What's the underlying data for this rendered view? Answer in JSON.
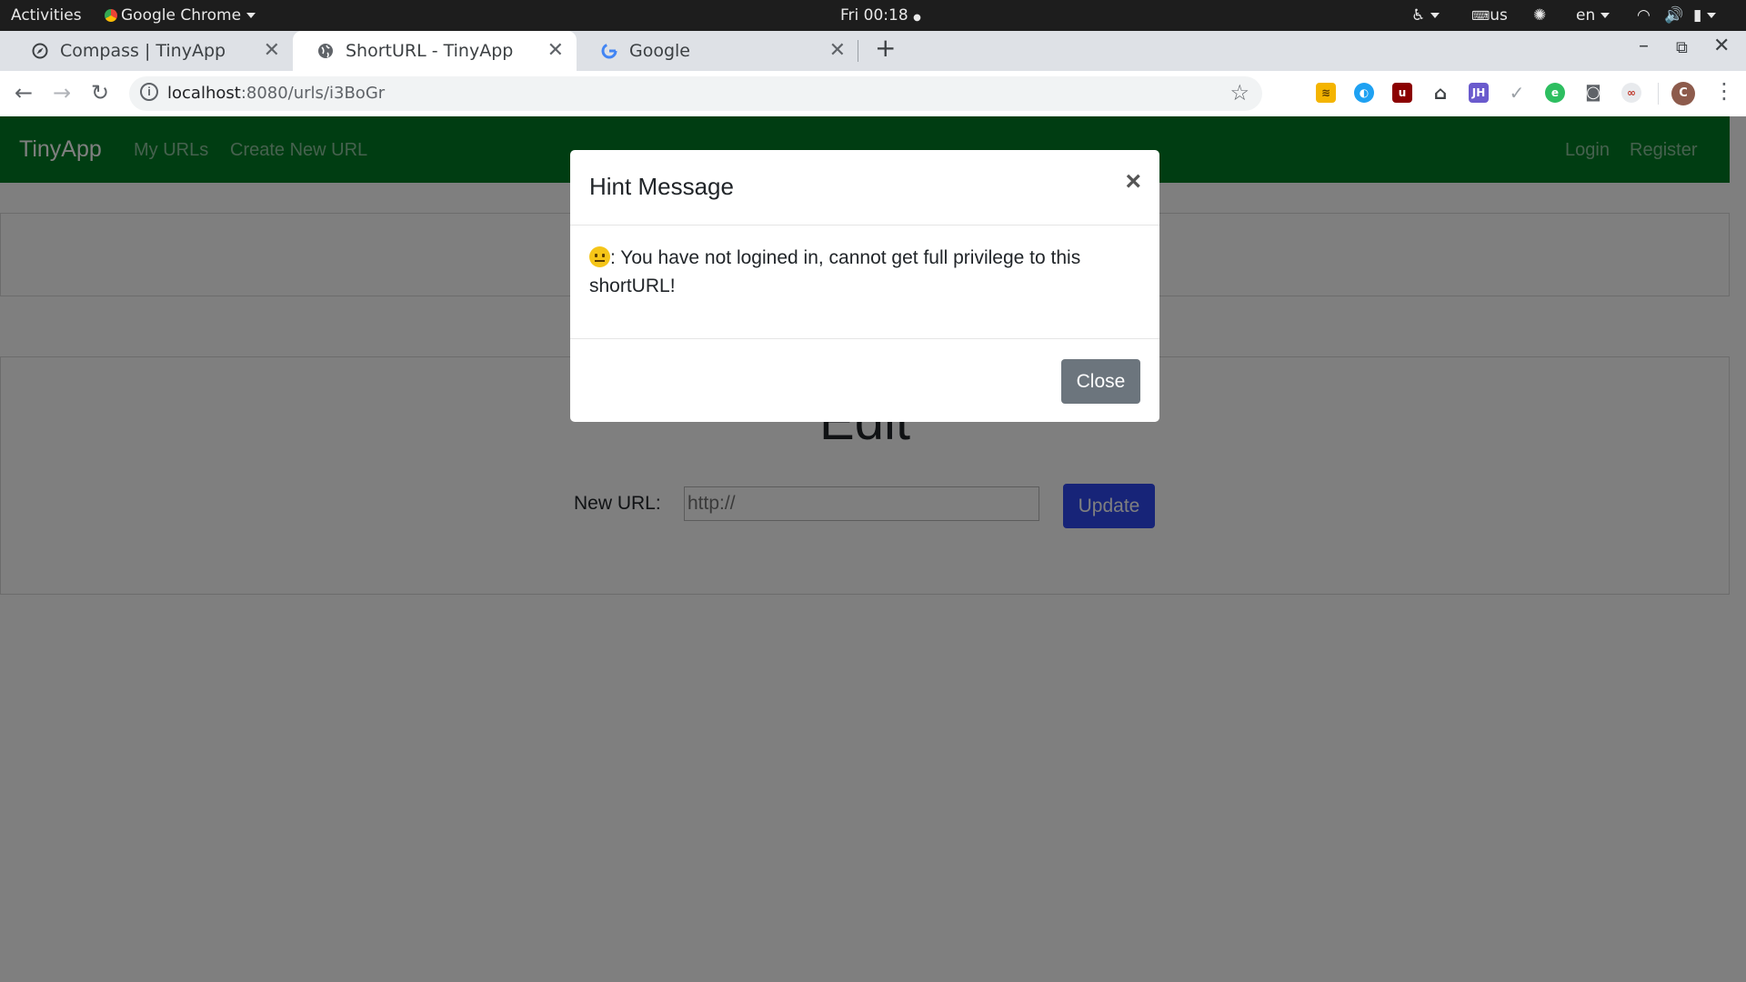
{
  "topbar": {
    "activities": "Activities",
    "app_name": "Google Chrome",
    "clock": "Fri 00:18",
    "keyboard": "us",
    "language": "en"
  },
  "tabs": [
    {
      "title": "Compass | TinyApp",
      "icon": "compass-icon",
      "active": false
    },
    {
      "title": "ShortURL - TinyApp",
      "icon": "globe-icon",
      "active": true
    },
    {
      "title": "Google",
      "icon": "google-icon",
      "active": false
    }
  ],
  "address_bar": {
    "host": "localhost",
    "path": ":8080/urls/i3BoGr"
  },
  "profile_initial": "C",
  "app": {
    "brand": "TinyApp",
    "nav_left": [
      "My URLs",
      "Create New URL"
    ],
    "nav_right": [
      "Login",
      "Register"
    ],
    "edit_title": "Edit",
    "new_url_label": "New URL:",
    "new_url_placeholder": "http://",
    "update_label": "Update",
    "nav_color": "#007a24",
    "button_color": "#2e49f0"
  },
  "modal": {
    "title": "Hint Message",
    "message": ": You have not logined in, cannot get full privilege to this shortURL!",
    "close_label": "Close",
    "close_x": "×"
  }
}
